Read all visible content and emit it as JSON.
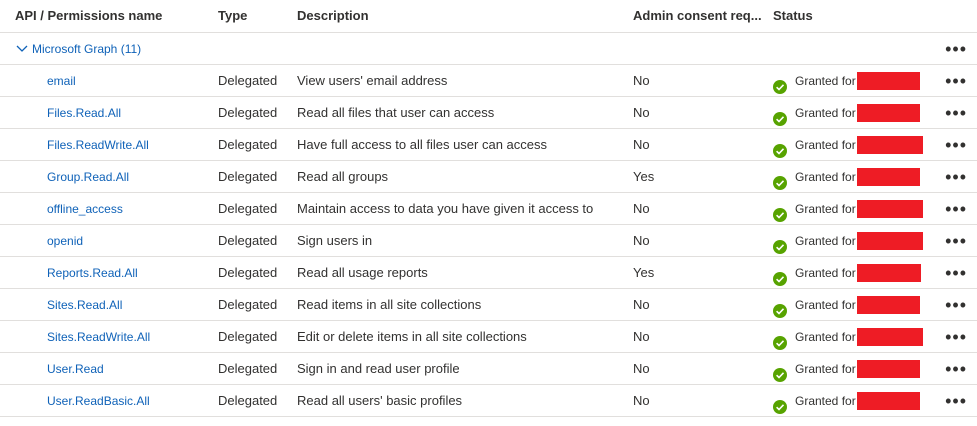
{
  "headers": {
    "name": "API / Permissions name",
    "type": "Type",
    "description": "Description",
    "admin": "Admin consent req...",
    "status": "Status"
  },
  "group": {
    "label": "Microsoft Graph (11)",
    "menu": "•••"
  },
  "rows": [
    {
      "name": "email",
      "type": "Delegated",
      "description": "View users' email address",
      "admin": "No",
      "status": "Granted for"
    },
    {
      "name": "Files.Read.All",
      "type": "Delegated",
      "description": "Read all files that user can access",
      "admin": "No",
      "status": "Granted for"
    },
    {
      "name": "Files.ReadWrite.All",
      "type": "Delegated",
      "description": "Have full access to all files user can access",
      "admin": "No",
      "status": "Granted for"
    },
    {
      "name": "Group.Read.All",
      "type": "Delegated",
      "description": "Read all groups",
      "admin": "Yes",
      "status": "Granted for"
    },
    {
      "name": "offline_access",
      "type": "Delegated",
      "description": "Maintain access to data you have given it access to",
      "admin": "No",
      "status": "Granted for"
    },
    {
      "name": "openid",
      "type": "Delegated",
      "description": "Sign users in",
      "admin": "No",
      "status": "Granted for"
    },
    {
      "name": "Reports.Read.All",
      "type": "Delegated",
      "description": "Read all usage reports",
      "admin": "Yes",
      "status": "Granted for"
    },
    {
      "name": "Sites.Read.All",
      "type": "Delegated",
      "description": "Read items in all site collections",
      "admin": "No",
      "status": "Granted for"
    },
    {
      "name": "Sites.ReadWrite.All",
      "type": "Delegated",
      "description": "Edit or delete items in all site collections",
      "admin": "No",
      "status": "Granted for"
    },
    {
      "name": "User.Read",
      "type": "Delegated",
      "description": "Sign in and read user profile",
      "admin": "No",
      "status": "Granted for"
    },
    {
      "name": "User.ReadBasic.All",
      "type": "Delegated",
      "description": "Read all users' basic profiles",
      "admin": "No",
      "status": "Granted for"
    }
  ],
  "row_menu": "•••",
  "colors": {
    "link": "#0f62b8",
    "granted": "#57a300",
    "redaction": "#ee1c25",
    "divider": "#e1dfdd"
  },
  "icons": {
    "group_toggle": "chevron-down-icon",
    "status": "check-circle-icon",
    "menu": "more-icon"
  }
}
